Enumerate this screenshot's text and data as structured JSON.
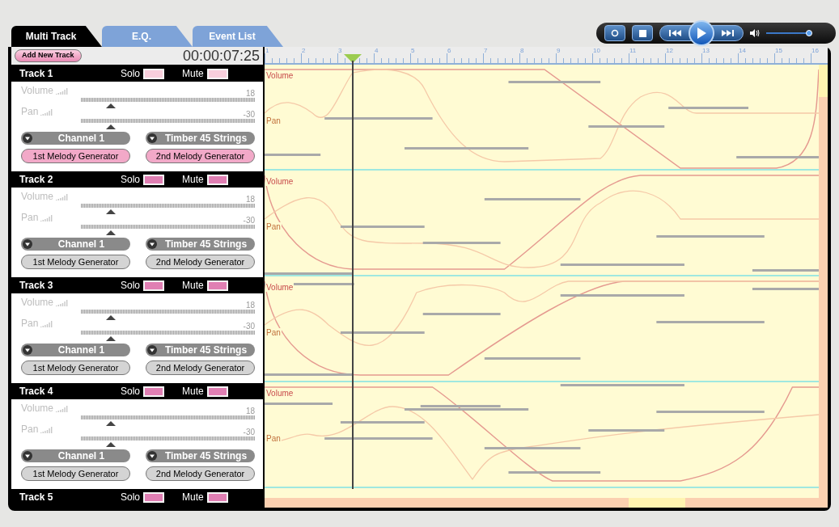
{
  "tabs": [
    {
      "label": "Multi Track",
      "selected": true
    },
    {
      "label": "E.Q.",
      "selected": false
    },
    {
      "label": "Event List",
      "selected": false
    }
  ],
  "transport": {
    "volume": {
      "level": 0.95
    }
  },
  "toolbar": {
    "add_button": "Add New Track",
    "time": "00:00:07:25"
  },
  "ruler": {
    "numbers": [
      "1",
      "2",
      "3",
      "4",
      "5",
      "6",
      "7",
      "8",
      "9",
      "10",
      "11",
      "12",
      "13",
      "14",
      "15",
      "16"
    ]
  },
  "tracks": [
    {
      "name": "Track 1",
      "selected": true,
      "solo": {
        "label": "Solo",
        "on": false
      },
      "mute": {
        "label": "Mute",
        "on": false
      },
      "volume": {
        "label": "Volume",
        "value": "18",
        "level": 0.17
      },
      "pan": {
        "label": "Pan",
        "value": "-30",
        "level": 0.17
      },
      "channel": "Channel 1",
      "timbre": "Timber 45 Strings",
      "generators": [
        "1st Melody Generator",
        "2nd Melody Generator"
      ]
    },
    {
      "name": "Track 2",
      "selected": false,
      "solo": {
        "label": "Solo",
        "on": true
      },
      "mute": {
        "label": "Mute",
        "on": true
      },
      "volume": {
        "label": "Volume",
        "value": "18",
        "level": 0.17
      },
      "pan": {
        "label": "Pan",
        "value": "-30",
        "level": 0.17
      },
      "channel": "Channel 1",
      "timbre": "Timber 45 Strings",
      "generators": [
        "1st Melody Generator",
        "2nd Melody Generator"
      ]
    },
    {
      "name": "Track 3",
      "selected": false,
      "solo": {
        "label": "Solo",
        "on": true
      },
      "mute": {
        "label": "Mute",
        "on": true
      },
      "volume": {
        "label": "Volume",
        "value": "18",
        "level": 0.17
      },
      "pan": {
        "label": "Pan",
        "value": "-30",
        "level": 0.17
      },
      "channel": "Channel 1",
      "timbre": "Timber 45 Strings",
      "generators": [
        "1st Melody Generator",
        "2nd Melody Generator"
      ]
    },
    {
      "name": "Track 4",
      "selected": false,
      "solo": {
        "label": "Solo",
        "on": true
      },
      "mute": {
        "label": "Mute",
        "on": true
      },
      "volume": {
        "label": "Volume",
        "value": "18",
        "level": 0.17
      },
      "pan": {
        "label": "Pan",
        "value": "-30",
        "level": 0.17
      },
      "channel": "Channel 1",
      "timbre": "Timber 45 Strings",
      "generators": [
        "1st Melody Generator",
        "2nd Melody Generator"
      ]
    },
    {
      "name": "Track 5",
      "solo": {
        "label": "Solo",
        "on": true
      },
      "mute": {
        "label": "Mute",
        "on": true
      }
    }
  ],
  "lanes": [
    {
      "volume_label": "Volume",
      "pan_label": "Pan"
    },
    {
      "volume_label": "Volume",
      "pan_label": "Pan"
    },
    {
      "volume_label": "Volume",
      "pan_label": "Pan"
    },
    {
      "volume_label": "Volume",
      "pan_label": "Pan"
    }
  ]
}
